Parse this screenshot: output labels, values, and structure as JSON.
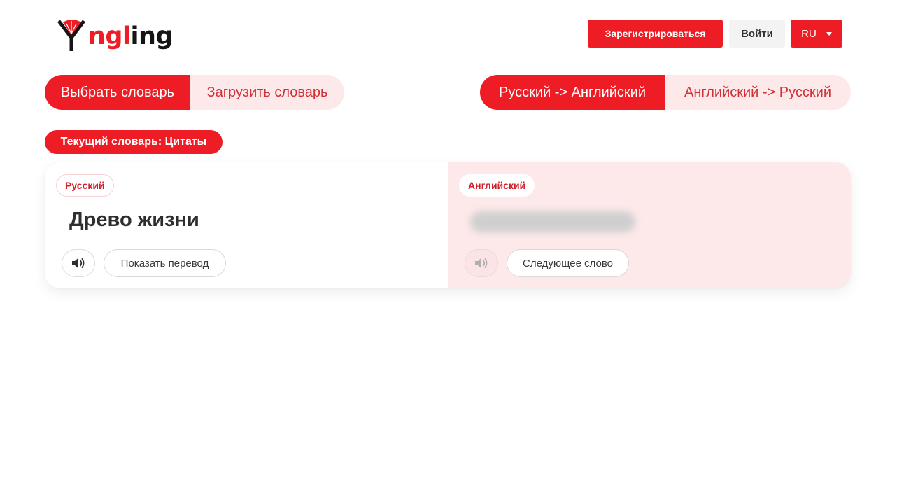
{
  "header": {
    "logo": {
      "text_red": "ngl",
      "text_dark": "ing",
      "icon": "y-logo-icon"
    },
    "register_label": "Зарегистрироваться",
    "login_label": "Войти",
    "language_label": "RU"
  },
  "dictionary_mode": {
    "choose_label": "Выбрать словарь",
    "upload_label": "Загрузить словарь",
    "active": "choose"
  },
  "direction": {
    "ru_en_label": "Русский -> Английский",
    "en_ru_label": "Английский -> Русский",
    "active": "ru_en"
  },
  "current_dictionary_label": "Текущий словарь: Цитаты",
  "card": {
    "left": {
      "language": "Русский",
      "word": "Древо жизни",
      "speak_icon": "speaker-icon",
      "action_label": "Показать перевод"
    },
    "right": {
      "language": "Английский",
      "speak_icon": "speaker-icon",
      "action_label": "Следующее слово"
    }
  },
  "colors": {
    "accent": "#ee1c25",
    "accent_light": "#fde9ea",
    "text": "#333333"
  }
}
